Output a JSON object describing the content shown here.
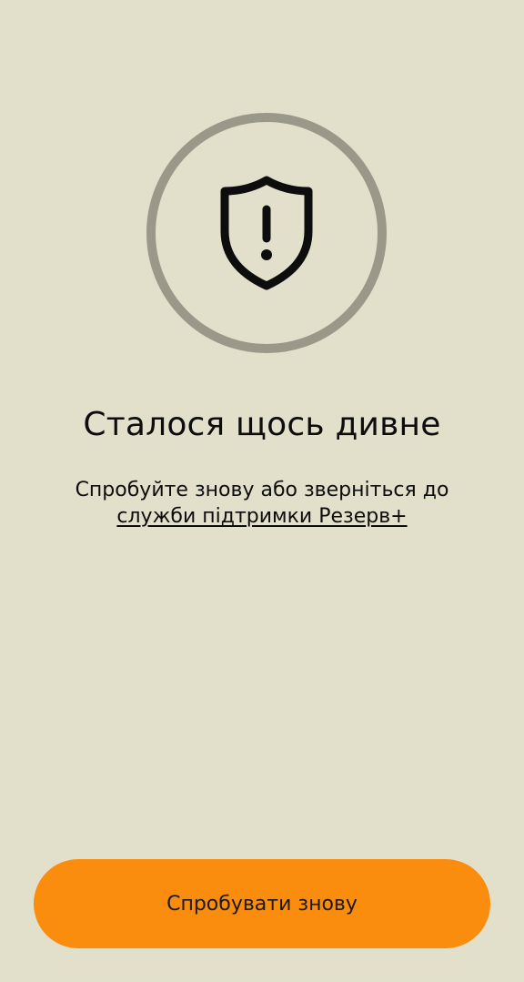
{
  "error_screen": {
    "icon": "shield-alert-icon",
    "title": "Сталося щось дивне",
    "message_prefix": "Спробуйте знову або зверніться до",
    "support_link_label": "служби підтримки Резерв+",
    "retry_button_label": "Спробувати знову"
  },
  "colors": {
    "background": "#e2dfca",
    "ring": "#9a9888",
    "accent_button": "#fa8c0e",
    "text": "#0d0d0d"
  }
}
